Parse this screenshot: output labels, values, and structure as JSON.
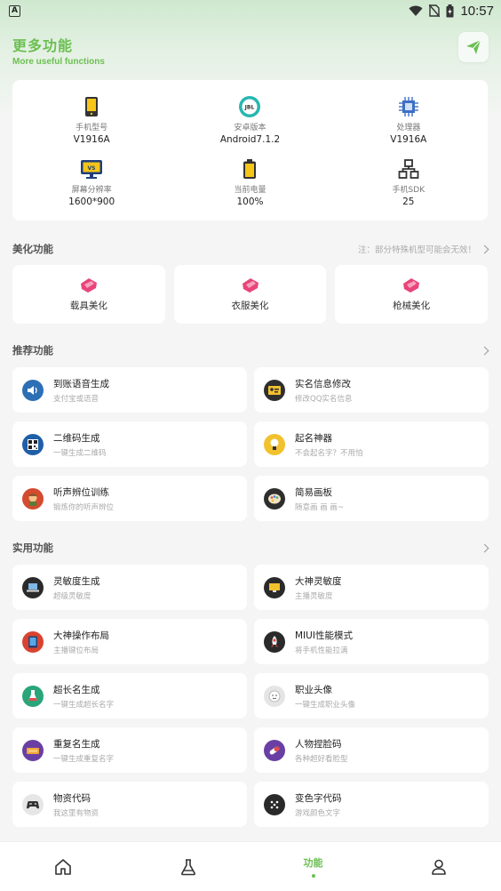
{
  "status_bar": {
    "time": "10:57",
    "indicator": "A"
  },
  "header": {
    "title": "更多功能",
    "subtitle": "More useful functions",
    "send_icon": "paper-plane-icon"
  },
  "device_info": [
    {
      "label": "手机型号",
      "value": "V1916A",
      "icon": "phone-icon"
    },
    {
      "label": "安卓版本",
      "value": "Android7.1.2",
      "icon": "android-version-icon"
    },
    {
      "label": "处理器",
      "value": "V1916A",
      "icon": "cpu-icon"
    },
    {
      "label": "屏幕分辨率",
      "value": "1600*900",
      "icon": "monitor-icon"
    },
    {
      "label": "当前电量",
      "value": "100%",
      "icon": "battery-icon"
    },
    {
      "label": "手机SDK",
      "value": "25",
      "icon": "sdk-tree-icon"
    }
  ],
  "beauty": {
    "title": "美化功能",
    "note": "注：部分特殊机型可能会无效！",
    "items": [
      {
        "label": "载具美化"
      },
      {
        "label": "衣服美化"
      },
      {
        "label": "枪械美化"
      }
    ]
  },
  "recommended": {
    "title": "推荐功能",
    "items": [
      {
        "title": "到账语音生成",
        "sub": "支付宝或语音",
        "icon": "speaker-icon",
        "color": "#2d6fb4"
      },
      {
        "title": "实名信息修改",
        "sub": "修改QQ实名信息",
        "icon": "id-card-icon",
        "color": "#2f2f2f"
      },
      {
        "title": "二维码生成",
        "sub": "一键生成二维码",
        "icon": "qrcode-icon",
        "color": "#1f5fa8"
      },
      {
        "title": "起名神器",
        "sub": "不会起名字？不用怕",
        "icon": "light-bulb-icon",
        "color": "#f2c12e"
      },
      {
        "title": "听声辨位训练",
        "sub": "锻炼你的听声辨位",
        "icon": "soldier-icon",
        "color": "#d44b2f"
      },
      {
        "title": "简易画板",
        "sub": "随意画 画 画~",
        "icon": "palette-icon",
        "color": "#2e2e2e"
      }
    ]
  },
  "practical": {
    "title": "实用功能",
    "items": [
      {
        "title": "灵敏度生成",
        "sub": "超级灵敏度",
        "icon": "laptop-icon",
        "color": "#2a2a2a"
      },
      {
        "title": "大神灵敏度",
        "sub": "主播灵敏度",
        "icon": "monitor-icon",
        "color": "#2a2a2a"
      },
      {
        "title": "大神操作布局",
        "sub": "主播键位布局",
        "icon": "tablet-icon",
        "color": "#d8432f"
      },
      {
        "title": "MIUI性能模式",
        "sub": "将手机性能拉满",
        "icon": "rocket-icon",
        "color": "#2a2a2a"
      },
      {
        "title": "超长名生成",
        "sub": "一键生成超长名字",
        "icon": "flask-icon",
        "color": "#2aa57a"
      },
      {
        "title": "职业头像",
        "sub": "一键生成职业头像",
        "icon": "face-icon",
        "color": "#e5e5e5"
      },
      {
        "title": "重复名生成",
        "sub": "一键生成重复名字",
        "icon": "ticket-icon",
        "color": "#6a3fa3"
      },
      {
        "title": "人物捏脸码",
        "sub": "各种超好看脸型",
        "icon": "pill-icon",
        "color": "#6a3fa3"
      },
      {
        "title": "物资代码",
        "sub": "我这里有物资",
        "icon": "gamepad-icon",
        "color": "#e6e6e6"
      },
      {
        "title": "变色字代码",
        "sub": "游戏颜色文字",
        "icon": "dice-icon",
        "color": "#2a2a2a"
      }
    ]
  },
  "bottom_nav": [
    {
      "name": "home-icon"
    },
    {
      "name": "flask-nav-icon"
    },
    {
      "label": "功能",
      "active": true
    },
    {
      "name": "profile-icon"
    }
  ]
}
